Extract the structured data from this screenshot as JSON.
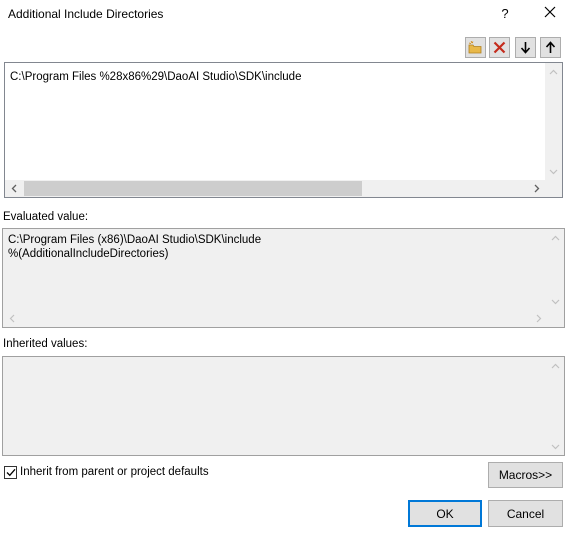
{
  "window": {
    "title": "Additional Include Directories",
    "help_label": "?"
  },
  "toolbar": {
    "icons": [
      "new-line-icon",
      "delete-icon",
      "move-down-icon",
      "move-up-icon"
    ]
  },
  "editor": {
    "value": "C:\\Program Files %28x86%29\\DaoAI Studio\\SDK\\include"
  },
  "evaluated": {
    "label": "Evaluated value:",
    "line1": "C:\\Program Files (x86)\\DaoAI Studio\\SDK\\include",
    "line2": "%(AdditionalIncludeDirectories)"
  },
  "inherited": {
    "label": "Inherited values:"
  },
  "inherit_checkbox": {
    "label": "Inherit from parent or project defaults",
    "checked": true
  },
  "buttons": {
    "macros": "Macros>>",
    "ok": "OK",
    "cancel": "Cancel"
  },
  "colors": {
    "accent": "#0078d7",
    "delete": "#c42b1c",
    "folder": "#e8b84a"
  }
}
